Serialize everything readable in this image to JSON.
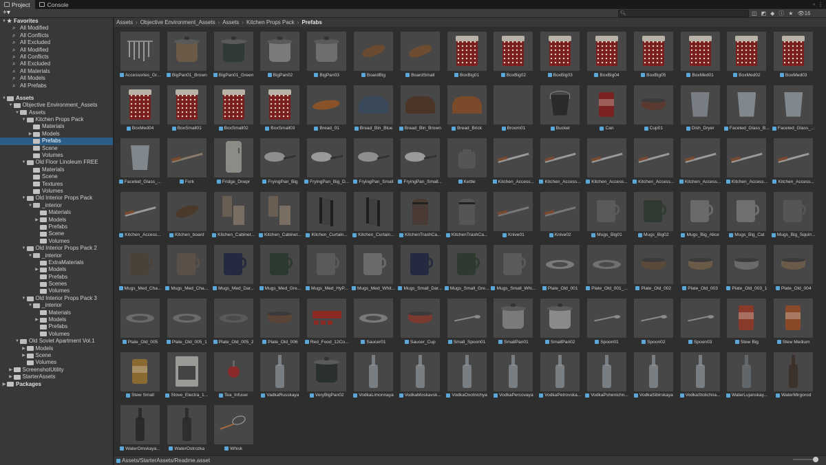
{
  "tabs": [
    {
      "label": "Project",
      "icon": "folder-icon"
    },
    {
      "label": "Console",
      "icon": "console-icon"
    }
  ],
  "toolbar": {
    "add_label": "+▾",
    "search_placeholder": "",
    "hidden_count": "16"
  },
  "favorites": {
    "title": "Favorites",
    "items": [
      "All Modified",
      "All Conflicts",
      "All Excluded",
      "All Modified",
      "All Conflicts",
      "All Excluded",
      "All Materials",
      "All Models",
      "All Prefabs"
    ]
  },
  "tree": [
    {
      "label": "Assets",
      "depth": 0,
      "header": true,
      "open": true
    },
    {
      "label": "Objective Environment_Assets",
      "depth": 1,
      "open": true
    },
    {
      "label": "Assets",
      "depth": 2,
      "open": true
    },
    {
      "label": "Kitchen Props Pack",
      "depth": 3,
      "open": true
    },
    {
      "label": "Materials",
      "depth": 4
    },
    {
      "label": "Models",
      "depth": 4,
      "arrow": true
    },
    {
      "label": "Prefabs",
      "depth": 4,
      "selected": true
    },
    {
      "label": "Scene",
      "depth": 4
    },
    {
      "label": "Volumes",
      "depth": 4
    },
    {
      "label": "Old Floor Linoleum FREE",
      "depth": 3,
      "open": true
    },
    {
      "label": "Materials",
      "depth": 4
    },
    {
      "label": "Scene",
      "depth": 4
    },
    {
      "label": "Textures",
      "depth": 4
    },
    {
      "label": "Volumes",
      "depth": 4
    },
    {
      "label": "Old Interior Props Pack",
      "depth": 3,
      "open": true
    },
    {
      "label": "_interior",
      "depth": 4,
      "open": true
    },
    {
      "label": "Materials",
      "depth": 5
    },
    {
      "label": "Models",
      "depth": 5,
      "arrow": true
    },
    {
      "label": "Prefabs",
      "depth": 5
    },
    {
      "label": "Scene",
      "depth": 5
    },
    {
      "label": "Volumes",
      "depth": 5
    },
    {
      "label": "Old Interior Props Pack 2",
      "depth": 3,
      "open": true
    },
    {
      "label": "_interior",
      "depth": 4,
      "open": true
    },
    {
      "label": "ExtraMaterials",
      "depth": 5
    },
    {
      "label": "Models",
      "depth": 5,
      "arrow": true
    },
    {
      "label": "Prefabs",
      "depth": 5
    },
    {
      "label": "Scenes",
      "depth": 5
    },
    {
      "label": "Volumes",
      "depth": 5
    },
    {
      "label": "Old Interior Props Pack 3",
      "depth": 3,
      "open": true
    },
    {
      "label": "_interior",
      "depth": 4,
      "open": true
    },
    {
      "label": "Materials",
      "depth": 5
    },
    {
      "label": "Models",
      "depth": 5,
      "arrow": true
    },
    {
      "label": "Prefabs",
      "depth": 5
    },
    {
      "label": "Volumes",
      "depth": 5
    },
    {
      "label": "Old Soviet Apartment Vol.1",
      "depth": 2,
      "open": true
    },
    {
      "label": "Models",
      "depth": 3,
      "arrow": true
    },
    {
      "label": "Scene",
      "depth": 3,
      "arrow": true
    },
    {
      "label": "Volumes",
      "depth": 3
    },
    {
      "label": "ScreenshotUtility",
      "depth": 1,
      "arrow": true
    },
    {
      "label": "StarterAssets",
      "depth": 1,
      "arrow": true
    },
    {
      "label": "Packages",
      "depth": 0,
      "header": true,
      "arrow": true
    }
  ],
  "breadcrumb": [
    "Assets",
    "Objective Environment_Assets",
    "Assets",
    "Kitchen Props Pack",
    "Prefabs"
  ],
  "assets": [
    {
      "label": "Accessories_Gr...",
      "shape": "rack"
    },
    {
      "label": "BigPan01_Brown",
      "shape": "pot",
      "color": "#6b5a48"
    },
    {
      "label": "BigPan01_Green",
      "shape": "pot",
      "color": "#2f3a35"
    },
    {
      "label": "BigPan02",
      "shape": "pot",
      "color": "#7a7a7a"
    },
    {
      "label": "BigPan03",
      "shape": "pot",
      "color": "#6e6e6e"
    },
    {
      "label": "BoardBig",
      "shape": "board",
      "color": "#6a4a30"
    },
    {
      "label": "BoardSmall",
      "shape": "board",
      "color": "#6e4c30"
    },
    {
      "label": "BoxBig01",
      "shape": "tin",
      "color": "#7a1f1f"
    },
    {
      "label": "BoxBig02",
      "shape": "tin",
      "color": "#7a1f1f"
    },
    {
      "label": "BoxBig03",
      "shape": "tin",
      "color": "#7a1f1f"
    },
    {
      "label": "BoxBig04",
      "shape": "tin",
      "color": "#7a1f1f"
    },
    {
      "label": "BoxBig05",
      "shape": "tin",
      "color": "#7a1f1f"
    },
    {
      "label": "BoxMed01",
      "shape": "tin",
      "color": "#7a1f1f"
    },
    {
      "label": "BoxMed02",
      "shape": "tin",
      "color": "#7a1f1f"
    },
    {
      "label": "BoxMed03",
      "shape": "tin",
      "color": "#7a1f1f"
    },
    {
      "label": "BoxMed04",
      "shape": "tin",
      "color": "#7a1f1f"
    },
    {
      "label": "BoxSmall01",
      "shape": "tin",
      "color": "#7a1f1f"
    },
    {
      "label": "BoxSmall02",
      "shape": "tin",
      "color": "#7a1f1f"
    },
    {
      "label": "BoxSmall03",
      "shape": "tin",
      "color": "#7a1f1f"
    },
    {
      "label": "Bread_01",
      "shape": "bread",
      "color": "#8a5228"
    },
    {
      "label": "Bread_Bin_Blue",
      "shape": "breadbin",
      "color": "#3a4a5a"
    },
    {
      "label": "Bread_Bin_Brown",
      "shape": "breadbin",
      "color": "#4a3528"
    },
    {
      "label": "Bread_Brick",
      "shape": "breadbin",
      "color": "#7a4a2a"
    },
    {
      "label": "Broom01",
      "shape": "none"
    },
    {
      "label": "Bucket",
      "shape": "bucket",
      "color": "#2a2a2a"
    },
    {
      "label": "Can",
      "shape": "can",
      "color": "#7a2222"
    },
    {
      "label": "Cup01",
      "shape": "bowl",
      "color": "#5a3a30"
    },
    {
      "label": "Dish_Dryer",
      "shape": "glass",
      "color": "#9aa4ae"
    },
    {
      "label": "Faceted_Glass_B...",
      "shape": "glass",
      "color": "#a8b4bd"
    },
    {
      "label": "Faceted_Glass_...",
      "shape": "glass",
      "color": "#a8b4bd"
    },
    {
      "label": "Faceted_Glass_...",
      "shape": "glass",
      "color": "#a8b4bd"
    },
    {
      "label": "Fork",
      "shape": "utensil",
      "color": "#8a7a6a"
    },
    {
      "label": "Fridge_Dnepr",
      "shape": "fridge",
      "color": "#8c8c86"
    },
    {
      "label": "FryingPan_Big",
      "shape": "pan",
      "color": "#8e8e8e"
    },
    {
      "label": "FryingPan_Big_D...",
      "shape": "pan",
      "color": "#9a9a9a"
    },
    {
      "label": "FryingPan_Small",
      "shape": "pan",
      "color": "#8e8e8e"
    },
    {
      "label": "FryingPan_Small...",
      "shape": "pan",
      "color": "#9a9a9a"
    },
    {
      "label": "Kettle",
      "shape": "kettle",
      "color": "#555555"
    },
    {
      "label": "Kitchen_Access...",
      "shape": "utensil",
      "color": "#9a9a9a"
    },
    {
      "label": "Kitchen_Access...",
      "shape": "utensil",
      "color": "#9a9a9a"
    },
    {
      "label": "Kitchen_Access...",
      "shape": "utensil",
      "color": "#9a9a9a"
    },
    {
      "label": "Kitchen_Access...",
      "shape": "utensil",
      "color": "#9a9a9a"
    },
    {
      "label": "Kitchen_Access...",
      "shape": "utensil",
      "color": "#9a9a9a"
    },
    {
      "label": "Kitchen_Access...",
      "shape": "utensil",
      "color": "#9a9a9a"
    },
    {
      "label": "Kitchen_Access...",
      "shape": "utensil",
      "color": "#9a9a9a"
    },
    {
      "label": "Kitchen_Access...",
      "shape": "utensil",
      "color": "#9a9a9a"
    },
    {
      "label": "Kitchen_board",
      "shape": "board",
      "color": "#4a3a2c"
    },
    {
      "label": "Kitchen_Cabinet...",
      "shape": "cabinet",
      "color": "#6a5e52"
    },
    {
      "label": "Kitchen_Cabinet...",
      "shape": "cabinet",
      "color": "#6a5e52"
    },
    {
      "label": "Kitchen_Curtain...",
      "shape": "curtain",
      "color": "#3a3a3a"
    },
    {
      "label": "Kitchen_Curtain...",
      "shape": "curtain",
      "color": "#3a3a3a"
    },
    {
      "label": "KitchenTrashCa...",
      "shape": "trash",
      "color": "#4a3a34"
    },
    {
      "label": "KitchenTrashCa...",
      "shape": "trash",
      "color": "#555555"
    },
    {
      "label": "Knive01",
      "shape": "utensil",
      "color": "#777777"
    },
    {
      "label": "Knive02",
      "shape": "utensil",
      "color": "#777777"
    },
    {
      "label": "Mugs_Big01",
      "shape": "mug",
      "color": "#5a5a5a"
    },
    {
      "label": "Mugs_Big02",
      "shape": "mug",
      "color": "#2f3a32"
    },
    {
      "label": "Mugs_Big_Alice",
      "shape": "mug",
      "color": "#6a6a6a"
    },
    {
      "label": "Mugs_Big_Cat",
      "shape": "mug",
      "color": "#707070"
    },
    {
      "label": "Mugs_Big_Squirr...",
      "shape": "mug",
      "color": "#555555"
    },
    {
      "label": "Mugs_Med_Cha...",
      "shape": "mug",
      "color": "#4a4238"
    },
    {
      "label": "Mugs_Med_Cha...",
      "shape": "mug",
      "color": "#5a5048"
    },
    {
      "label": "Mugs_Med_Dar...",
      "shape": "mug",
      "color": "#262a40"
    },
    {
      "label": "Mugs_Med_Gre...",
      "shape": "mug",
      "color": "#2a3a30"
    },
    {
      "label": "Mugs_Med_HyP...",
      "shape": "mug",
      "color": "#5a5a5a"
    },
    {
      "label": "Mugs_Med_Whit...",
      "shape": "mug",
      "color": "#6a6a6a"
    },
    {
      "label": "Mugs_Small_Dar...",
      "shape": "mug",
      "color": "#262a40"
    },
    {
      "label": "Mugs_Small_Gre...",
      "shape": "mug",
      "color": "#2e3a30"
    },
    {
      "label": "Mugs_Small_Whi...",
      "shape": "mug",
      "color": "#5a5a5a"
    },
    {
      "label": "Plate_Old_001",
      "shape": "plate",
      "color": "#7a7a7a"
    },
    {
      "label": "Plate_Old_001_...",
      "shape": "plate",
      "color": "#707070"
    },
    {
      "label": "Plate_Old_002",
      "shape": "bowl",
      "color": "#5a4a3a"
    },
    {
      "label": "Plate_Old_003",
      "shape": "bowl",
      "color": "#6a5a48"
    },
    {
      "label": "Plate_Old_003_1",
      "shape": "bowl",
      "color": "#6a6a6a"
    },
    {
      "label": "Plate_Old_004",
      "shape": "bowl",
      "color": "#6a5a4a"
    },
    {
      "label": "Plate_Old_005",
      "shape": "plate",
      "color": "#6a6a6a"
    },
    {
      "label": "Plate_Old_005_1",
      "shape": "plate",
      "color": "#6a6a6a"
    },
    {
      "label": "Plate_Old_005_2",
      "shape": "plate",
      "color": "#5a5a5a"
    },
    {
      "label": "Plate_Old_006",
      "shape": "bowl",
      "color": "#5a4438"
    },
    {
      "label": "Red_Food_12Co...",
      "shape": "redfood",
      "color": "#8a2a22"
    },
    {
      "label": "Saucer01",
      "shape": "plate",
      "color": "#7a7a7a"
    },
    {
      "label": "Saucer_Cup",
      "shape": "bowl",
      "color": "#7a3a30"
    },
    {
      "label": "Small_Spoon01",
      "shape": "spoon",
      "color": "#8a8a8a"
    },
    {
      "label": "SmallPan01",
      "shape": "pot",
      "color": "#7a7a7a"
    },
    {
      "label": "SmallPan02",
      "shape": "pot",
      "color": "#8a8a8a"
    },
    {
      "label": "Spoon01",
      "shape": "spoon",
      "color": "#8a8a8a"
    },
    {
      "label": "Spoon02",
      "shape": "spoon",
      "color": "#8a8a8a"
    },
    {
      "label": "Spoon03",
      "shape": "spoon",
      "color": "#8a8a8a"
    },
    {
      "label": "Stew Big",
      "shape": "can",
      "color": "#8a3a2a"
    },
    {
      "label": "Stew Medium",
      "shape": "can",
      "color": "#8a4a2a"
    },
    {
      "label": "Stew Small",
      "shape": "can",
      "color": "#8a6a30"
    },
    {
      "label": "Stove_Electra_1...",
      "shape": "stove",
      "color": "#9a9a96"
    },
    {
      "label": "Tea_Infuser",
      "shape": "infuser",
      "color": "#8a2a2a"
    },
    {
      "label": "VadkaRusskaya",
      "shape": "bottle",
      "color": "#8a9096"
    },
    {
      "label": "VeryBigPan02",
      "shape": "pot",
      "color": "#2a302c"
    },
    {
      "label": "VodkaLimonnaya",
      "shape": "bottle",
      "color": "#8a9096"
    },
    {
      "label": "VodkaMoskavsk...",
      "shape": "bottle",
      "color": "#8a9096"
    },
    {
      "label": "VodkaOxotnichya",
      "shape": "bottle",
      "color": "#8a9096"
    },
    {
      "label": "VodkaPercovaya",
      "shape": "bottle",
      "color": "#8a9096"
    },
    {
      "label": "VodkaPetrovska...",
      "shape": "bottle",
      "color": "#8a9096"
    },
    {
      "label": "VodkaPshenichn...",
      "shape": "bottle",
      "color": "#8a9096"
    },
    {
      "label": "VodkaSibirskaya",
      "shape": "bottle",
      "color": "#8a9096"
    },
    {
      "label": "VodkaStolichna...",
      "shape": "bottle",
      "color": "#8a9096"
    },
    {
      "label": "WaterLujanskay...",
      "shape": "bottle",
      "color": "#6a7076"
    },
    {
      "label": "WaterMirgorod",
      "shape": "bottle",
      "color": "#3a2a22"
    },
    {
      "label": "WaterOmskaya...",
      "shape": "bottle",
      "color": "#222222"
    },
    {
      "label": "WaterOstrozka",
      "shape": "bottle",
      "color": "#262626"
    },
    {
      "label": "Whisk",
      "shape": "whisk",
      "color": "#9a9a9a"
    }
  ],
  "status": {
    "path": "Assets/StarterAssets/Readme.asset"
  },
  "colors": {
    "selection": "#2c5d87",
    "prefab_icon": "#5aa7d8",
    "panel": "#383838",
    "grid_bg": "#2e2e2e"
  }
}
